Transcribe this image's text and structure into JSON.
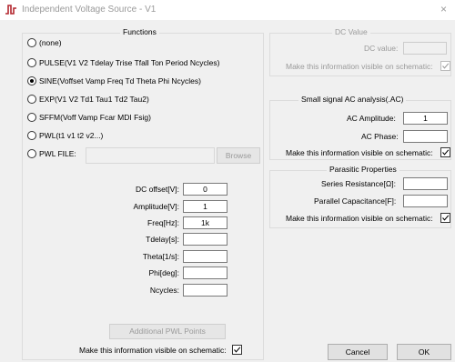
{
  "window": {
    "title": "Independent Voltage Source - V1",
    "close": "×"
  },
  "functions": {
    "legend": "Functions",
    "options": [
      {
        "label": "(none)",
        "selected": false
      },
      {
        "label": "PULSE(V1 V2 Tdelay Trise Tfall Ton Period Ncycles)",
        "selected": false
      },
      {
        "label": "SINE(Voffset Vamp Freq Td Theta Phi Ncycles)",
        "selected": true
      },
      {
        "label": "EXP(V1 V2 Td1 Tau1 Td2 Tau2)",
        "selected": false
      },
      {
        "label": "SFFM(Voff Vamp Fcar MDI Fsig)",
        "selected": false
      },
      {
        "label": "PWL(t1 v1 t2 v2...)",
        "selected": false
      },
      {
        "label": "PWL FILE:",
        "selected": false
      }
    ],
    "browse": "Browse",
    "params": [
      {
        "label": "DC offset[V]:",
        "value": "0"
      },
      {
        "label": "Amplitude[V]:",
        "value": "1"
      },
      {
        "label": "Freq[Hz]:",
        "value": "1k"
      },
      {
        "label": "Tdelay[s]:",
        "value": ""
      },
      {
        "label": "Theta[1/s]:",
        "value": ""
      },
      {
        "label": "Phi[deg]:",
        "value": ""
      },
      {
        "label": "Ncycles:",
        "value": ""
      }
    ],
    "additional_pwl": "Additional PWL Points",
    "visible_label": "Make this information visible on schematic:",
    "visible_checked": true
  },
  "dc_value": {
    "legend": "DC Value",
    "label": "DC value:",
    "value": "",
    "visible_label": "Make this information visible on schematic:",
    "visible_checked": true
  },
  "ac": {
    "legend": "Small signal AC analysis(.AC)",
    "amplitude_label": "AC Amplitude:",
    "amplitude_value": "1",
    "phase_label": "AC Phase:",
    "phase_value": "",
    "visible_label": "Make this information visible on schematic:",
    "visible_checked": true
  },
  "parasitic": {
    "legend": "Parasitic Properties",
    "series_label": "Series Resistance[Ω]:",
    "series_value": "",
    "parallel_label": "Parallel Capacitance[F]:",
    "parallel_value": "",
    "visible_label": "Make this information visible on schematic:",
    "visible_checked": true
  },
  "buttons": {
    "cancel": "Cancel",
    "ok": "OK"
  }
}
